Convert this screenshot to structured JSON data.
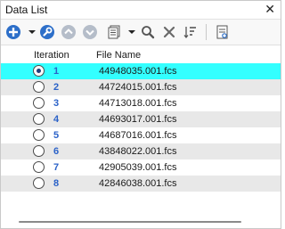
{
  "window": {
    "title": "Data List",
    "close_glyph": "✕"
  },
  "toolbar": {
    "buttons": [
      {
        "name": "add-icon",
        "color": "#2d6fc9"
      },
      {
        "name": "wrench-icon",
        "color": "#2d6fc9"
      },
      {
        "name": "move-up-icon",
        "color": "#b5bdc9"
      },
      {
        "name": "move-down-icon",
        "color": "#b5bdc9"
      },
      {
        "name": "document-menu-icon"
      },
      {
        "name": "search-icon"
      },
      {
        "name": "delete-icon"
      },
      {
        "name": "sort-icon"
      },
      {
        "name": "properties-icon"
      }
    ]
  },
  "table": {
    "headers": {
      "iteration": "Iteration",
      "file_name": "File Name"
    },
    "rows": [
      {
        "iteration": "1",
        "file_name": "44948035.001.fcs",
        "selected": true
      },
      {
        "iteration": "2",
        "file_name": "44724015.001.fcs",
        "selected": false
      },
      {
        "iteration": "3",
        "file_name": "44713018.001.fcs",
        "selected": false
      },
      {
        "iteration": "4",
        "file_name": "44693017.001.fcs",
        "selected": false
      },
      {
        "iteration": "5",
        "file_name": "44687016.001.fcs",
        "selected": false
      },
      {
        "iteration": "6",
        "file_name": "43848022.001.fcs",
        "selected": false
      },
      {
        "iteration": "7",
        "file_name": "42905039.001.fcs",
        "selected": false
      },
      {
        "iteration": "8",
        "file_name": "42846038.001.fcs",
        "selected": false
      }
    ]
  },
  "colors": {
    "selected_row": "#33ffff",
    "alt_row": "#e8e8e8",
    "iteration_text": "#2b62c8",
    "accent": "#2d6fc9"
  }
}
